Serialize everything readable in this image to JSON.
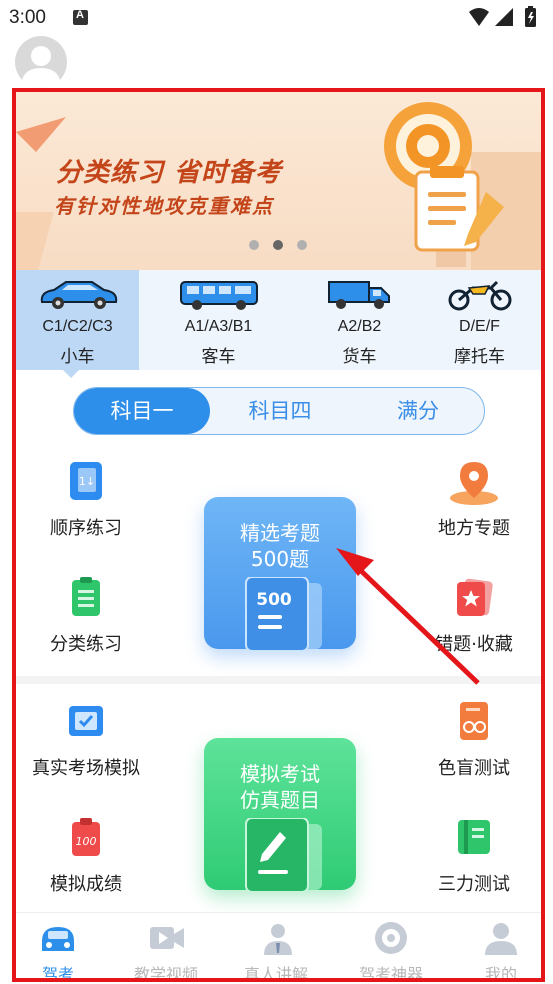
{
  "status_bar": {
    "time": "3:00"
  },
  "banner": {
    "title": "分类练习 省时备考",
    "subtitle": "有针对性地攻克重难点",
    "pages": 3,
    "active_page": 2
  },
  "vehicles": [
    {
      "line1": "C1/C2/C3",
      "line2": "小车",
      "icon": "car-icon",
      "active": true
    },
    {
      "line1": "A1/A3/B1",
      "line2": "客车",
      "icon": "bus-icon",
      "active": false
    },
    {
      "line1": "A2/B2",
      "line2": "货车",
      "icon": "truck-icon",
      "active": false
    },
    {
      "line1": "D/E/F",
      "line2": "摩托车",
      "icon": "motorcycle-icon",
      "active": false
    }
  ],
  "subjects": {
    "tabs": [
      "科目一",
      "科目四",
      "满分"
    ],
    "active": 0
  },
  "practice": {
    "left": [
      {
        "label": "顺序练习",
        "icon": "sequence-book-icon"
      },
      {
        "label": "分类练习",
        "icon": "category-list-icon"
      }
    ],
    "right": [
      {
        "label": "地方专题",
        "icon": "location-pin-icon"
      },
      {
        "label": "错题·收藏",
        "icon": "favorite-star-icon"
      }
    ],
    "card": {
      "line1": "精选考题",
      "line2": "500题",
      "badge": "500"
    }
  },
  "exam": {
    "left": [
      {
        "label": "真实考场模拟",
        "icon": "exam-room-icon"
      },
      {
        "label": "模拟成绩",
        "icon": "score-100-icon"
      }
    ],
    "right": [
      {
        "label": "色盲测试",
        "icon": "color-blind-test-icon"
      },
      {
        "label": "三力测试",
        "icon": "three-ability-test-icon"
      }
    ],
    "card": {
      "line1": "模拟考试",
      "line2": "仿真题目"
    }
  },
  "bottom_nav": [
    {
      "label": "驾考",
      "icon": "driving-test-icon",
      "active": true
    },
    {
      "label": "教学视频",
      "icon": "video-icon",
      "active": false
    },
    {
      "label": "真人讲解",
      "icon": "lecturer-icon",
      "active": false
    },
    {
      "label": "驾考神器",
      "icon": "toolbox-icon",
      "active": false
    },
    {
      "label": "我的",
      "icon": "profile-icon",
      "active": false
    }
  ],
  "colors": {
    "accent_blue": "#2d8fea",
    "frame_red": "#e4161a",
    "card_blue": "#5aa8f2",
    "card_green": "#3ed27e",
    "banner_text": "#c4451a"
  }
}
